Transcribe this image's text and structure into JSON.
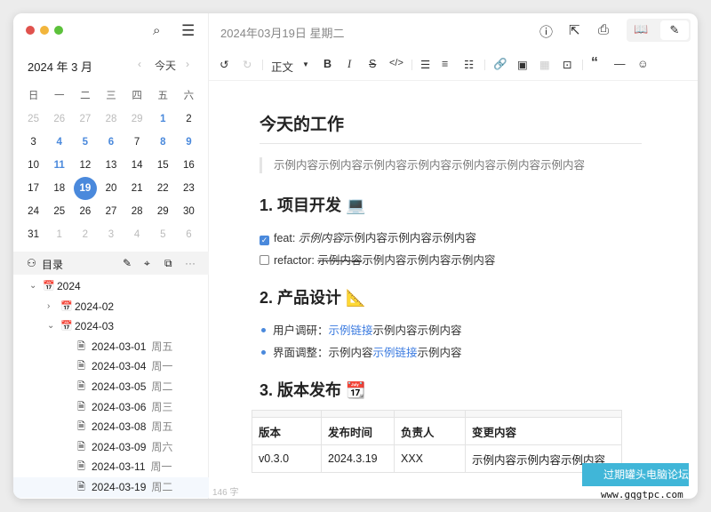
{
  "window": {
    "traffic_lights": [
      "#e0524d",
      "#f2b53c",
      "#5cc13b"
    ]
  },
  "sidebar": {
    "search_icon": "search-icon",
    "menu_icon": "menu-icon",
    "calendar": {
      "title": "2024 年 3 月",
      "today": "今天",
      "weekdays": [
        "日",
        "一",
        "二",
        "三",
        "四",
        "五",
        "六"
      ],
      "days": [
        {
          "d": "25",
          "s": "muted"
        },
        {
          "d": "26",
          "s": "muted"
        },
        {
          "d": "27",
          "s": "muted"
        },
        {
          "d": "28",
          "s": "muted"
        },
        {
          "d": "29",
          "s": "muted"
        },
        {
          "d": "1",
          "s": "blue"
        },
        {
          "d": "2",
          "s": ""
        },
        {
          "d": "3",
          "s": ""
        },
        {
          "d": "4",
          "s": "blue"
        },
        {
          "d": "5",
          "s": "blue"
        },
        {
          "d": "6",
          "s": "blue"
        },
        {
          "d": "7",
          "s": ""
        },
        {
          "d": "8",
          "s": "blue"
        },
        {
          "d": "9",
          "s": "blue"
        },
        {
          "d": "10",
          "s": ""
        },
        {
          "d": "11",
          "s": "blue"
        },
        {
          "d": "12",
          "s": ""
        },
        {
          "d": "13",
          "s": ""
        },
        {
          "d": "14",
          "s": ""
        },
        {
          "d": "15",
          "s": ""
        },
        {
          "d": "16",
          "s": ""
        },
        {
          "d": "17",
          "s": ""
        },
        {
          "d": "18",
          "s": ""
        },
        {
          "d": "19",
          "s": "sel"
        },
        {
          "d": "20",
          "s": ""
        },
        {
          "d": "21",
          "s": ""
        },
        {
          "d": "22",
          "s": ""
        },
        {
          "d": "23",
          "s": ""
        },
        {
          "d": "24",
          "s": ""
        },
        {
          "d": "25",
          "s": ""
        },
        {
          "d": "26",
          "s": ""
        },
        {
          "d": "27",
          "s": ""
        },
        {
          "d": "28",
          "s": ""
        },
        {
          "d": "29",
          "s": ""
        },
        {
          "d": "30",
          "s": ""
        },
        {
          "d": "31",
          "s": ""
        },
        {
          "d": "1",
          "s": "muted"
        },
        {
          "d": "2",
          "s": "muted"
        },
        {
          "d": "3",
          "s": "muted"
        },
        {
          "d": "4",
          "s": "muted"
        },
        {
          "d": "5",
          "s": "muted"
        },
        {
          "d": "6",
          "s": "muted"
        }
      ]
    },
    "outline": {
      "label": "目录",
      "more": "···"
    },
    "tree": [
      {
        "label": "2024",
        "level": 0,
        "type": "folder",
        "chev": "⌄"
      },
      {
        "label": "2024-02",
        "level": 1,
        "type": "folder",
        "chev": "›"
      },
      {
        "label": "2024-03",
        "level": 1,
        "type": "folder",
        "chev": "⌄"
      },
      {
        "label": "2024-03-01",
        "week": "周五",
        "level": 2,
        "type": "file"
      },
      {
        "label": "2024-03-04",
        "week": "周一",
        "level": 2,
        "type": "file"
      },
      {
        "label": "2024-03-05",
        "week": "周二",
        "level": 2,
        "type": "file"
      },
      {
        "label": "2024-03-06",
        "week": "周三",
        "level": 2,
        "type": "file"
      },
      {
        "label": "2024-03-08",
        "week": "周五",
        "level": 2,
        "type": "file"
      },
      {
        "label": "2024-03-09",
        "week": "周六",
        "level": 2,
        "type": "file"
      },
      {
        "label": "2024-03-11",
        "week": "周一",
        "level": 2,
        "type": "file"
      },
      {
        "label": "2024-03-19",
        "week": "周二",
        "level": 2,
        "type": "file",
        "active": true
      }
    ]
  },
  "header": {
    "date": "2024年03月19日 星期二"
  },
  "toolbar": {
    "style": "正文"
  },
  "doc": {
    "title": "今天的工作",
    "quote": "示例内容示例内容示例内容示例内容示例内容示例内容示例内容",
    "h1": "1. 项目开发 💻",
    "task1": {
      "prefix": "feat: ",
      "italic": "示例内容",
      "rest": "示例内容示例内容示例内容",
      "checked": true
    },
    "task2": {
      "prefix": "refactor: ",
      "strike": "示例内容",
      "rest": "示例内容示例内容示例内容",
      "checked": false
    },
    "h2": "2. 产品设计 📐",
    "b1": {
      "a": "用户调研：",
      "link": "示例链接",
      "b": "示例内容示例内容"
    },
    "b2": {
      "a": "界面调整：示例内容",
      "link": "示例链接",
      "b": "示例内容"
    },
    "h3": "3. 版本发布 📆",
    "table": {
      "headers": [
        "版本",
        "发布时间",
        "负责人",
        "变更内容"
      ],
      "rows": [
        [
          "v0.3.0",
          "2024.3.19",
          "XXX",
          "示例内容示例内容示例内容"
        ]
      ]
    }
  },
  "footer": {
    "word_count": "146 字"
  },
  "watermark": {
    "text": "过期罐头电脑论坛",
    "url": "www.gqgtpc.com"
  }
}
